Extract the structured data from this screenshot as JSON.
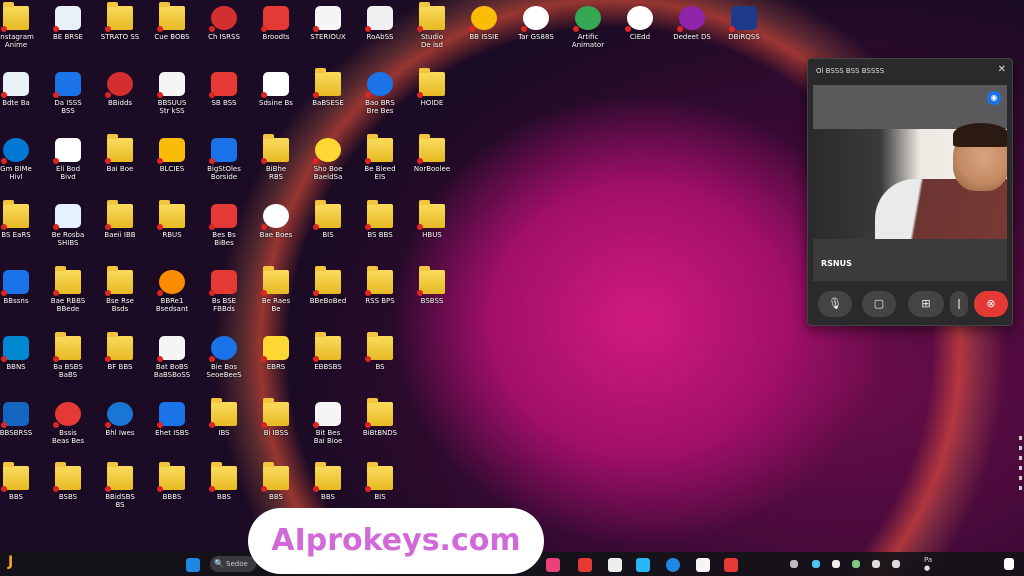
{
  "desktop": {
    "icons": [
      {
        "kind": "folder",
        "label": "Instagram\nAnime",
        "color": "#e8b923"
      },
      {
        "kind": "app",
        "label": "BE  BRSE",
        "color": "#e8f0f8"
      },
      {
        "kind": "folder",
        "label": "STRATO SS",
        "color": "#e8b923"
      },
      {
        "kind": "folder",
        "label": "Cue BOBS",
        "color": "#e8b923"
      },
      {
        "kind": "app",
        "round": true,
        "label": "Ch ISRSS",
        "color": "#d32f2f"
      },
      {
        "kind": "app",
        "label": "Broodts",
        "color": "#e53935"
      },
      {
        "kind": "app",
        "label": "STERIOUX",
        "color": "#f5f5f5"
      },
      {
        "kind": "app",
        "label": "RoAbSS",
        "color": "#f0f0f0"
      },
      {
        "kind": "folder",
        "label": "Studio\nDe isd",
        "color": "#e8b923"
      },
      {
        "kind": "app",
        "round": true,
        "label": "BB ISSIE",
        "color": "#fbbc05"
      },
      {
        "kind": "app",
        "round": true,
        "label": "Tar GS88S",
        "color": "#ffffff"
      },
      {
        "kind": "app",
        "round": true,
        "label": "Artific\nAnimator",
        "color": "#34a853"
      },
      {
        "kind": "app",
        "round": true,
        "label": "CiEdd",
        "color": "#ffffff"
      },
      {
        "kind": "app",
        "round": true,
        "label": "Dedeet DS",
        "color": "#8e24aa"
      },
      {
        "kind": "app",
        "label": "DBiRQSS",
        "color": "#1e3a8a"
      },
      {
        "kind": "app",
        "label": "Bdte Ba",
        "color": "#e8f0f8"
      },
      {
        "kind": "app",
        "label": "Da  ISSS\nBSS",
        "color": "#1a73e8"
      },
      {
        "kind": "app",
        "round": true,
        "label": "BBidds",
        "color": "#d32f2f"
      },
      {
        "kind": "app",
        "label": "BBSUUS\nStr kSS",
        "color": "#f5f5f5"
      },
      {
        "kind": "app",
        "label": "SB  BSS",
        "color": "#e53935"
      },
      {
        "kind": "app",
        "label": "Sdsine Bs",
        "color": "#ffffff"
      },
      {
        "kind": "folder",
        "label": "BaBSESE",
        "color": "#e8b923"
      },
      {
        "kind": "app",
        "round": true,
        "label": "Bao  BRS\nBre Bes",
        "color": "#1a73e8"
      },
      {
        "kind": "folder",
        "label": "HOIDE",
        "color": "#e8b923"
      },
      {
        "kind": "app",
        "round": true,
        "label": "Gm BIMe\nHivl",
        "color": "#0078d4"
      },
      {
        "kind": "app",
        "label": "Eli  Bod\nBivd",
        "color": "#ffffff"
      },
      {
        "kind": "folder",
        "label": "Bai Boe",
        "color": "#e8b923"
      },
      {
        "kind": "app",
        "label": "BLCIES",
        "color": "#fbbc05"
      },
      {
        "kind": "app",
        "label": "BigStOles\nBorside",
        "color": "#1a73e8"
      },
      {
        "kind": "folder",
        "label": "BiBhe\nRBS",
        "color": "#e8b923"
      },
      {
        "kind": "app",
        "round": true,
        "label": "Sho Boe\nBaeldSa",
        "color": "#fdd835"
      },
      {
        "kind": "folder",
        "label": "Be Bieed\nEIS",
        "color": "#e8b923"
      },
      {
        "kind": "folder",
        "label": "NorBoolee",
        "color": "#e8b923"
      },
      {
        "kind": "folder",
        "label": "BS EaRS",
        "color": "#e8b923"
      },
      {
        "kind": "app",
        "label": "Be  Rosba\nSHIBS",
        "color": "#e3f2fd"
      },
      {
        "kind": "folder",
        "label": "Baeii IBB",
        "color": "#e8b923"
      },
      {
        "kind": "folder",
        "label": "RBUS",
        "color": "#e8b923"
      },
      {
        "kind": "app",
        "label": "Bes  Bs\nBiBes",
        "color": "#e53935"
      },
      {
        "kind": "app",
        "round": true,
        "label": "Bae Boes",
        "color": "#ffffff"
      },
      {
        "kind": "folder",
        "label": "BIS",
        "color": "#e8b923"
      },
      {
        "kind": "folder",
        "label": "BS  BBS",
        "color": "#e8b923"
      },
      {
        "kind": "folder",
        "label": "HBUS",
        "color": "#e8b923"
      },
      {
        "kind": "app",
        "label": "BBssns",
        "color": "#1a73e8"
      },
      {
        "kind": "folder",
        "label": "Bae  RBBS\nBBede",
        "color": "#e8b923"
      },
      {
        "kind": "folder",
        "label": "Bse  Rse\nBsds",
        "color": "#e8b923"
      },
      {
        "kind": "app",
        "round": true,
        "label": "BBRe1\nBsedsant",
        "color": "#fb8c00"
      },
      {
        "kind": "app",
        "label": "Bs BSE\nFBBds",
        "color": "#e53935"
      },
      {
        "kind": "folder",
        "label": "Be  Raes\nBe",
        "color": "#e8b923"
      },
      {
        "kind": "folder",
        "label": "BBeBoBed",
        "color": "#e8b923"
      },
      {
        "kind": "folder",
        "label": "RSS BPS",
        "color": "#e8b923"
      },
      {
        "kind": "folder",
        "label": "BSBSS",
        "color": "#e8b923"
      },
      {
        "kind": "app",
        "label": "BBNS",
        "color": "#0288d1"
      },
      {
        "kind": "folder",
        "label": "Ba  BSBS\nBaBS",
        "color": "#e8b923"
      },
      {
        "kind": "folder",
        "label": "BF  BBS",
        "color": "#e8b923"
      },
      {
        "kind": "app",
        "label": "Bat BoBS\nBaBSBoSS",
        "color": "#f5f5f5"
      },
      {
        "kind": "app",
        "round": true,
        "label": "Bie Bos\nSeoeBeeS",
        "color": "#1a73e8"
      },
      {
        "kind": "app",
        "label": "EBRS",
        "color": "#fdd835"
      },
      {
        "kind": "folder",
        "label": "EBBSBS",
        "color": "#e8b923"
      },
      {
        "kind": "folder",
        "label": "BS",
        "color": "#e8b923"
      },
      {
        "kind": "app",
        "label": "BBSBRSS",
        "color": "#1565c0"
      },
      {
        "kind": "app",
        "round": true,
        "label": "Bssis\nBeas Bes",
        "color": "#e53935"
      },
      {
        "kind": "app",
        "round": true,
        "label": "Bhl Iwes",
        "color": "#1976d2"
      },
      {
        "kind": "app",
        "label": "Ehet ISBS",
        "color": "#1a73e8"
      },
      {
        "kind": "folder",
        "label": "IBS",
        "color": "#e8b923"
      },
      {
        "kind": "folder",
        "label": "Bi  IBSS",
        "color": "#e8b923"
      },
      {
        "kind": "app",
        "label": "Bit Bes\nBai Bioe",
        "color": "#f5f5f5"
      },
      {
        "kind": "folder",
        "label": "BiBtBNDS",
        "color": "#e8b923"
      },
      {
        "kind": "folder",
        "label": "BBS",
        "color": "#e8b923"
      },
      {
        "kind": "folder",
        "label": "BSBS",
        "color": "#e8b923"
      },
      {
        "kind": "folder",
        "label": "BBidSBS\nBS",
        "color": "#e8b923"
      },
      {
        "kind": "folder",
        "label": "BBBS",
        "color": "#e8b923"
      },
      {
        "kind": "folder",
        "label": "BBS",
        "color": "#e8b923"
      },
      {
        "kind": "folder",
        "label": "BBS",
        "color": "#e8b923"
      },
      {
        "kind": "folder",
        "label": "BBS",
        "color": "#e8b923"
      },
      {
        "kind": "folder",
        "label": "BIS",
        "color": "#e8b923"
      }
    ]
  },
  "call_window": {
    "title": "Ol  BSSS BSS BSSSS",
    "close": "✕",
    "caller": "RSNUS",
    "badge": "◉",
    "controls": [
      "🎙",
      "▢",
      "⊞",
      "ǀ",
      "⊗"
    ]
  },
  "watermark": "AIprokeys.com",
  "taskbar": {
    "start_glyph": "J",
    "search_label": "Sedoe",
    "tray_text": "Pa\n●"
  }
}
